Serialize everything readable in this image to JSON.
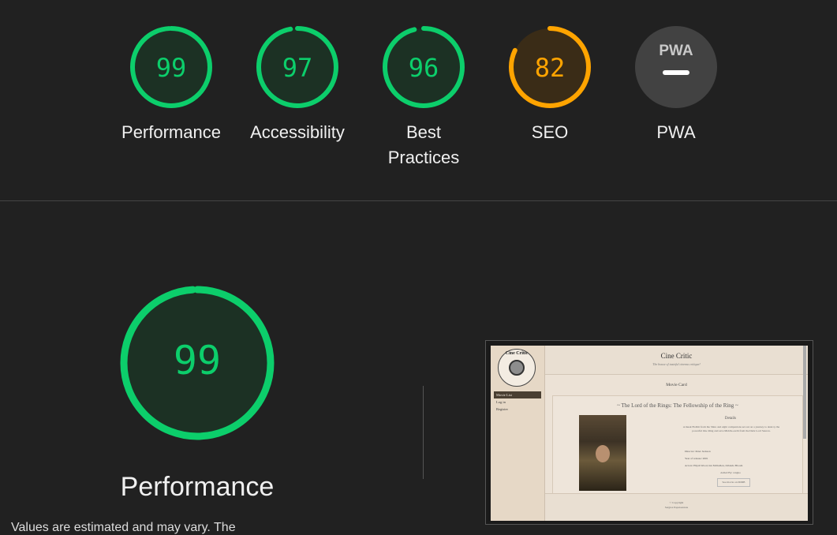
{
  "colors": {
    "good": "#0cce6b",
    "average": "#ffa400",
    "na": "#9e9e9e"
  },
  "categories": [
    {
      "label": "Performance",
      "score": "99",
      "value": 0.99,
      "status": "good"
    },
    {
      "label": "Accessibility",
      "score": "97",
      "value": 0.97,
      "status": "good"
    },
    {
      "label": "Best Practices",
      "score": "96",
      "value": 0.96,
      "status": "good"
    },
    {
      "label": "SEO",
      "score": "82",
      "value": 0.82,
      "status": "average"
    },
    {
      "label": "PWA",
      "badge": "PWA",
      "status": "na"
    }
  ],
  "main": {
    "score": "99",
    "value": 0.99,
    "label": "Performance",
    "description": "Values are estimated and may vary. The"
  },
  "screenshot": {
    "site_title": "Cine Critic",
    "site_subtitle": "The house of tasteful cinema critique!",
    "logo_text": "Cine Critic",
    "nav": [
      "Movie List",
      "Log in",
      "Register"
    ],
    "card_heading": "Movie Card",
    "movie_title": "~ The Lord of the Rings: The Fellowship of the Ring ~",
    "details_heading": "Details",
    "description": "A meek Hobbit from the Shire and eight companions set out on a journey to destroy the powerful One Ring and save Middle-earth from the Dark Lord Sauron.",
    "director": "Director: Peter Jackson",
    "year": "Year of release: 2001",
    "actors": "Actors: Elijah Wood, Ian McKellen, Orlando Bloom",
    "added_by": "Added By: rangko",
    "imdb_button": "See movie on IMDB",
    "footer_copyright": "© Copyright",
    "footer_author": "Sergios Papaioannou"
  }
}
